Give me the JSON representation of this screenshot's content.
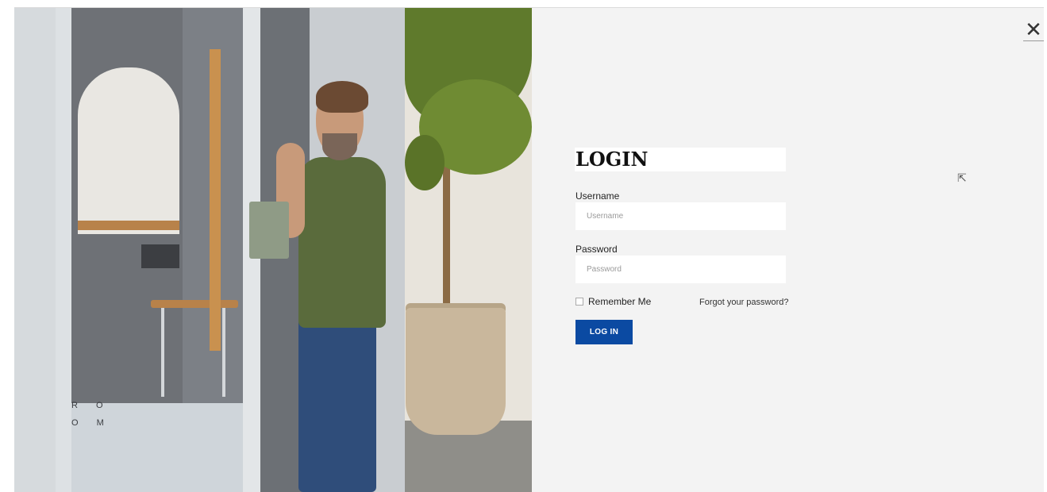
{
  "photo": {
    "alt_icon": "room-photo-image",
    "room_label": "R O O M"
  },
  "login": {
    "title": "LOGIN",
    "username_label": "Username",
    "username_placeholder": "Username",
    "username_value": "",
    "password_label": "Password",
    "password_placeholder": "Password",
    "password_value": "",
    "remember_label": "Remember Me",
    "remember_checked": false,
    "forgot_label": "Forgot your password?",
    "submit_label": "LOG IN"
  },
  "modal": {
    "close_symbol": "✕",
    "close_icon": "close-icon"
  },
  "colors": {
    "background": "#f3f3f3",
    "accent": "#0b4aa2"
  }
}
